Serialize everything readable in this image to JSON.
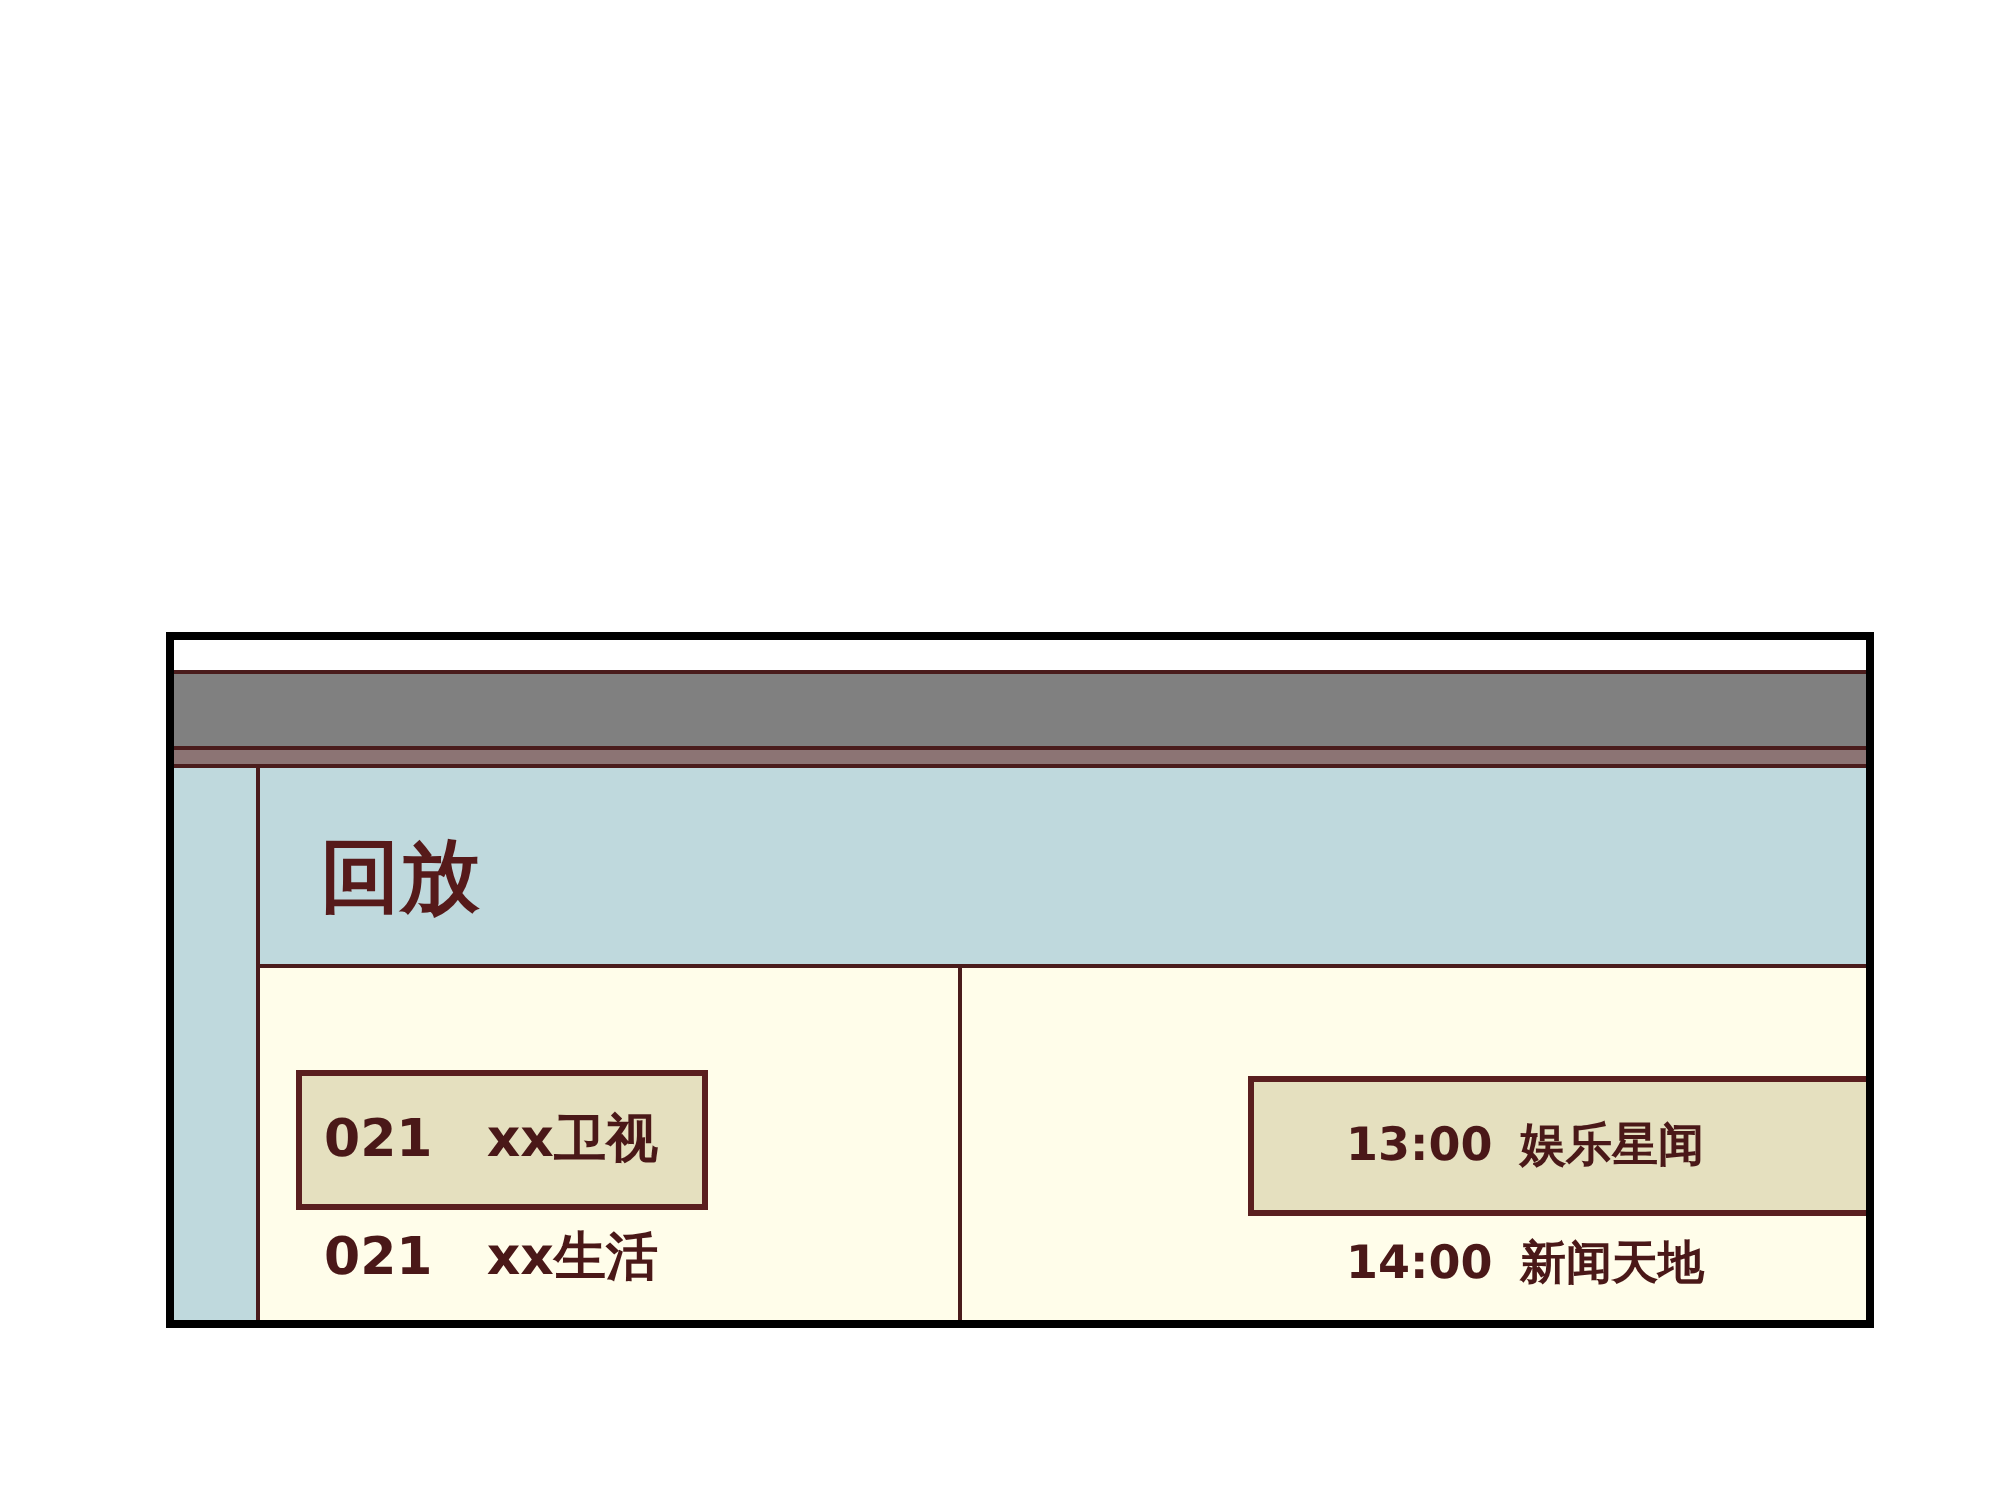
{
  "screen": {
    "title": "回放"
  },
  "channels": [
    {
      "number": "021",
      "name": "xx卫视",
      "selected": true
    },
    {
      "number": "021",
      "name": "xx生活",
      "selected": false
    }
  ],
  "programs": [
    {
      "time": "13:00",
      "title": "娱乐星闻",
      "selected": true
    },
    {
      "time": "14:00",
      "title": "新闻天地",
      "selected": false
    }
  ]
}
